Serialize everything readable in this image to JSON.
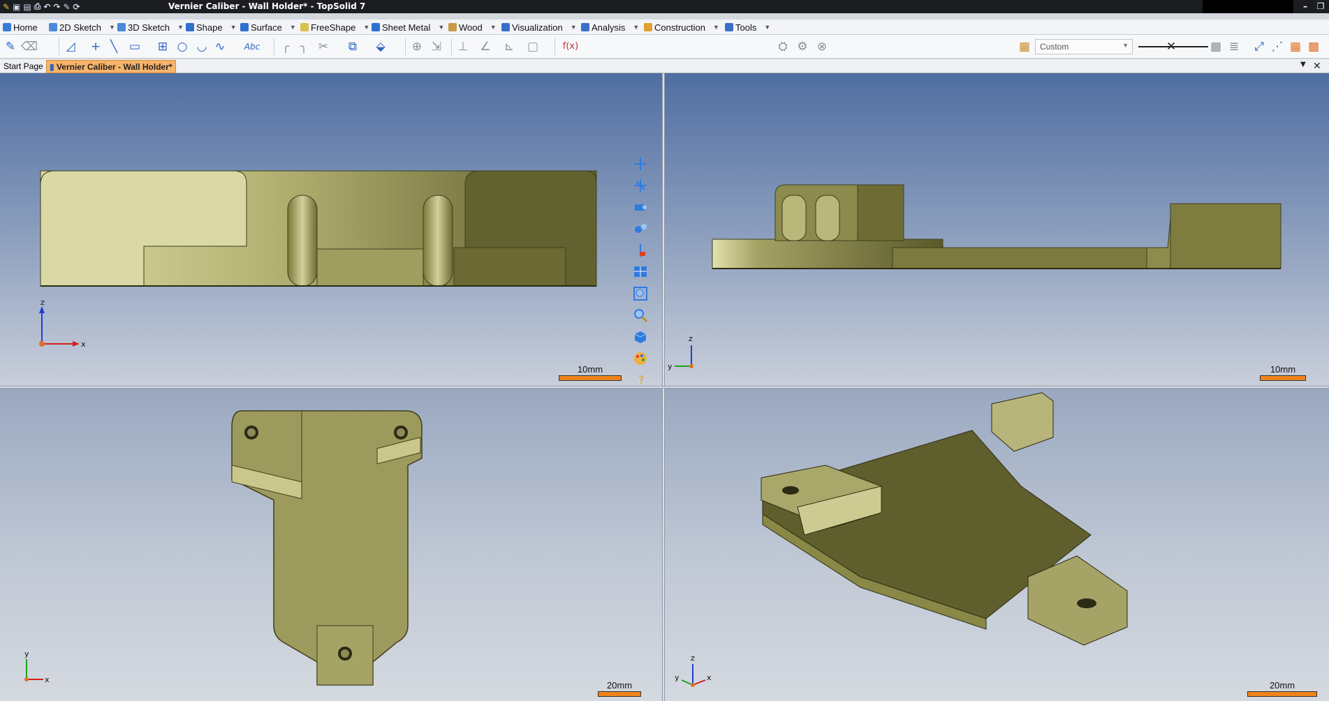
{
  "window": {
    "title": "Vernier Caliber - Wall Holder* - TopSolid 7"
  },
  "menu": {
    "tabs": [
      {
        "label": "Home"
      },
      {
        "label": "2D Sketch"
      },
      {
        "label": "3D Sketch"
      },
      {
        "label": "Shape"
      },
      {
        "label": "Surface"
      },
      {
        "label": "FreeShape"
      },
      {
        "label": "Sheet Metal"
      },
      {
        "label": "Wood"
      },
      {
        "label": "Visualization"
      },
      {
        "label": "Analysis"
      },
      {
        "label": "Construction"
      },
      {
        "label": "Tools"
      }
    ]
  },
  "toolbar": {
    "style_combo": "Custom",
    "text_tool_label": "Abc",
    "formula_label": "f(x)"
  },
  "doc_tabs": [
    {
      "label": "Start Page"
    },
    {
      "label": "Vernier Caliber - Wall Holder*"
    }
  ],
  "viewports": {
    "front": {
      "scale_label": "10mm",
      "axis": {
        "v": "z",
        "h": "x"
      }
    },
    "side": {
      "scale_label": "10mm",
      "axis": {
        "v": "z",
        "h": "y"
      }
    },
    "top": {
      "scale_label": "20mm",
      "axis": {
        "v": "y",
        "h": "x"
      }
    },
    "iso": {
      "scale_label": "20mm",
      "axis": {
        "v": "z",
        "h1": "y",
        "h2": "x"
      }
    }
  },
  "colors": {
    "part_face": "#9a9a5a",
    "part_dark": "#5e5e2c",
    "part_light": "#d7d6a0",
    "scale_bar": "#f0841c",
    "active_tab": "#f6b36a"
  }
}
